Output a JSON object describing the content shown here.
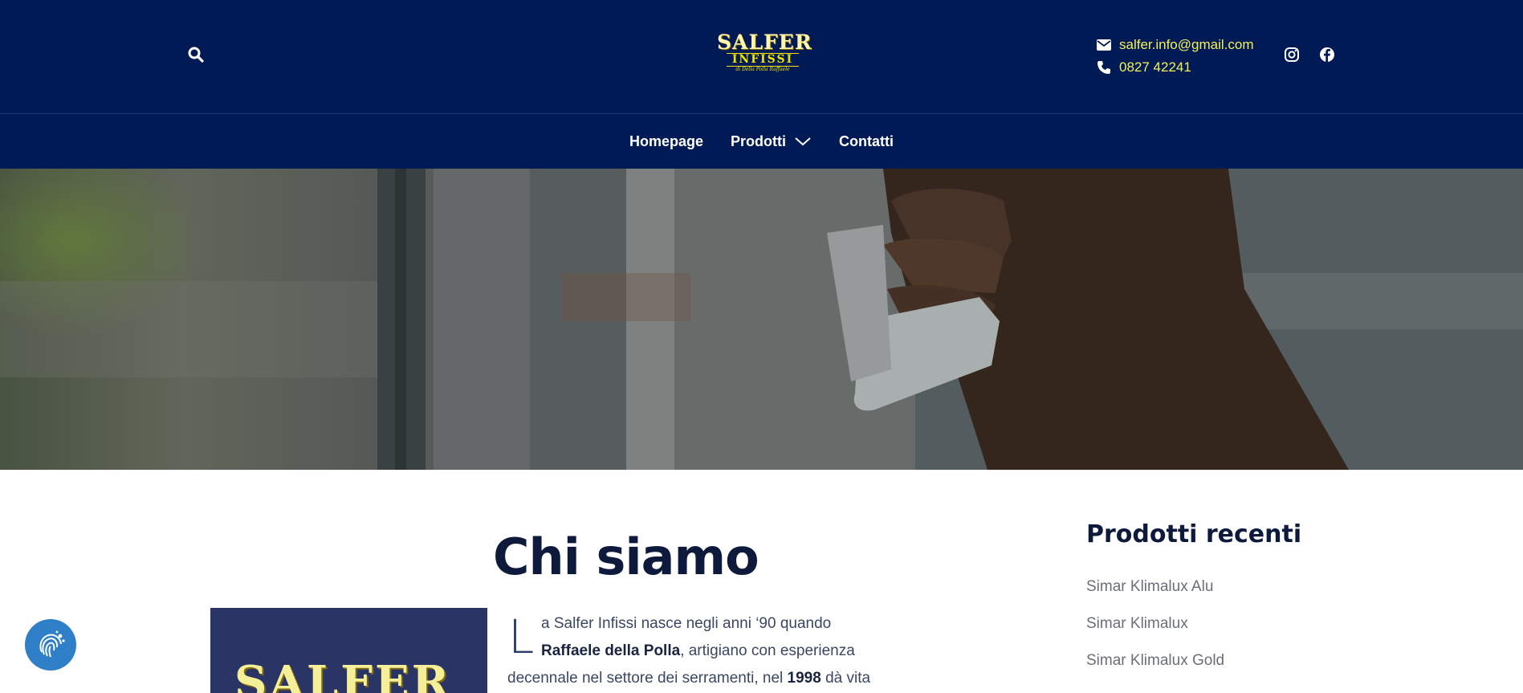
{
  "header": {
    "logo": {
      "line1": "SALFER",
      "line2": "INFISSI",
      "line3": "di Della Polla Raffaele"
    },
    "contact": {
      "email": "salfer.info@gmail.com",
      "phone": "0827 42241"
    },
    "icons": {
      "search": "search-icon",
      "email": "envelope-icon",
      "phone": "phone-icon",
      "instagram": "instagram-icon",
      "facebook": "facebook-icon"
    }
  },
  "nav": {
    "items": [
      {
        "label": "Homepage"
      },
      {
        "label": "Prodotti"
      },
      {
        "label": "Contatti"
      }
    ]
  },
  "main": {
    "title": "Chi siamo",
    "image_logo_text": "SALFER",
    "dropcap": "L",
    "para_line1": "a Salfer Infissi nasce negli anni ‘90 quando",
    "para_bold1": "Raffaele della Polla",
    "para_line2": ", artigiano con esperienza",
    "para_line3a": "decennale nel settore dei serramenti, nel ",
    "para_bold2": "1998",
    "para_line3b": " dà vita"
  },
  "sidebar": {
    "title": "Prodotti recenti",
    "items": [
      {
        "label": "Simar Klimalux Alu"
      },
      {
        "label": "Simar Klimalux"
      },
      {
        "label": "Simar Klimalux Gold"
      }
    ]
  },
  "colors": {
    "header_bg": "#001a55",
    "accent_yellow": "#f4f05a",
    "title_dark": "#0e1a3b",
    "access_blue": "#2e7fc8"
  }
}
